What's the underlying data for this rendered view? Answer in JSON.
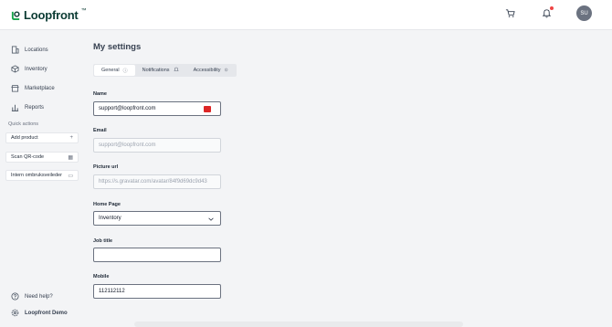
{
  "app": {
    "logo_text": "Loopfront",
    "logo_tm": "™"
  },
  "topbar": {
    "avatar_initials": "SU",
    "icons": [
      "cart-icon",
      "bell-icon"
    ]
  },
  "sidebar": {
    "items": [
      {
        "label": "Locations",
        "icon": "building-icon"
      },
      {
        "label": "Inventory",
        "icon": "box-icon"
      },
      {
        "label": "Marketplace",
        "icon": "store-icon"
      },
      {
        "label": "Reports",
        "icon": "bar-chart-icon"
      }
    ],
    "quick_actions_title": "Quick actions",
    "quick_actions": [
      {
        "label": "Add product",
        "icon": "+"
      },
      {
        "label": "Scan QR-code",
        "icon": "▦"
      },
      {
        "label": "Intern ombruksveileder",
        "icon": "▭"
      }
    ],
    "footer": [
      {
        "label": "Need help?",
        "icon": "help-icon"
      },
      {
        "label": "Loopfront Demo",
        "icon": "gear-icon"
      }
    ]
  },
  "page": {
    "title": "My settings",
    "tabs": [
      {
        "label": "General",
        "icon": "ⓘ"
      },
      {
        "label": "Notifications",
        "icon": "🔔"
      },
      {
        "label": "Accessibility",
        "icon": "⊙"
      }
    ],
    "fields": {
      "name": {
        "label": "Name",
        "value": "support@loopfront.com"
      },
      "email": {
        "label": "Email",
        "value": "support@loopfront.com"
      },
      "picture_url": {
        "label": "Picture url",
        "placeholder": "https://s.gravatar.com/avatar/84f9d69dc9d43"
      },
      "home_page": {
        "label": "Home Page",
        "value": "Inventory"
      },
      "job_title": {
        "label": "Job title",
        "value": ""
      },
      "mobile": {
        "label": "Mobile",
        "value": "112112112"
      }
    }
  },
  "colors": {
    "brand": "#0b3b33",
    "notification": "#ef4444"
  }
}
